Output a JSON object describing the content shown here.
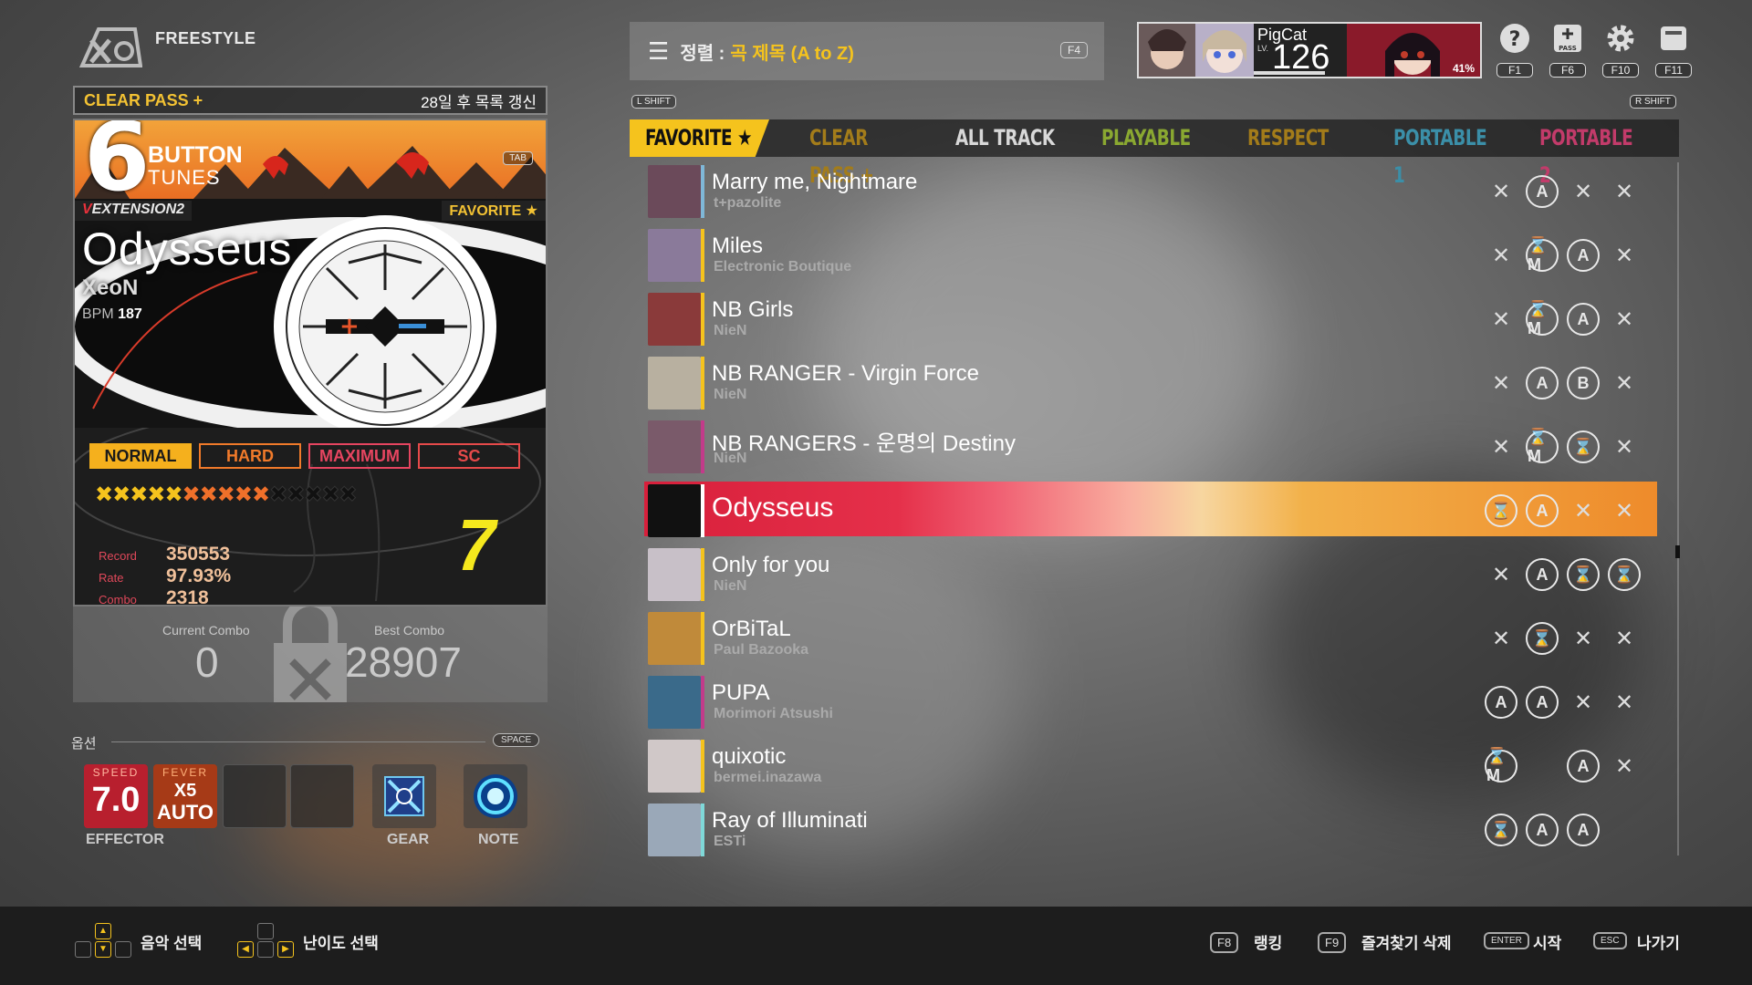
{
  "app": {
    "mode": "FREESTYLE"
  },
  "left": {
    "clear_pass": "CLEAR PASS +",
    "refresh_notice": "28일 후 목록 갱신",
    "button_count": "6",
    "button_label": "BUTTON",
    "tunes_label": "TUNES",
    "tab_key": "TAB",
    "pack_v": "V",
    "pack_rest": "EXTENSION2",
    "favorite_tag": "FAVORITE ★",
    "song_title": "Odysseus",
    "artist": "XeoN",
    "bpm_label": "BPM",
    "bpm_value": "187",
    "difficulties": [
      "NORMAL",
      "HARD",
      "MAXIMUM",
      "SC"
    ],
    "selected_difficulty": "NORMAL",
    "level_stars": {
      "yellow": 5,
      "orange": 5,
      "empty": 5
    },
    "record_label": "Record",
    "record_value": "350553",
    "rate_label": "Rate",
    "rate_value": "97.93%",
    "combo_label": "Combo",
    "combo_value": "2318",
    "grade": "7"
  },
  "combo_panel": {
    "current_label": "Current Combo",
    "current_value": "0",
    "best_label": "Best Combo",
    "best_value": "28907"
  },
  "options": {
    "label": "옵션",
    "space_key": "SPACE",
    "speed_title": "SPEED",
    "speed_value": "7.0",
    "fever_title": "FEVER",
    "fever_multiplier": "X5",
    "fever_mode": "AUTO",
    "effector_label": "EFFECTOR",
    "gear_label": "GEAR",
    "note_label": "NOTE"
  },
  "sort": {
    "label": "정렬 :",
    "value": "곡 제목 (A to Z)",
    "key": "F4"
  },
  "profile": {
    "name": "PigCat",
    "lv_label": "LV.",
    "level": "126",
    "progress_percent": "41%"
  },
  "system_buttons": [
    {
      "icon": "help-icon",
      "key": "F1"
    },
    {
      "icon": "pass-icon",
      "key": "F6",
      "icon_text": "PASS"
    },
    {
      "icon": "gear-icon",
      "key": "F10"
    },
    {
      "icon": "card-icon",
      "key": "F11"
    }
  ],
  "shift_keys": {
    "left": "L SHIFT",
    "right": "R SHIFT"
  },
  "tabs": [
    {
      "label": "FAVORITE ★",
      "color": "#111111",
      "active": true
    },
    {
      "label": "CLEAR PASS +",
      "color": "#a37c1a"
    },
    {
      "label": "ALL TRACK",
      "color": "#d8d8d8"
    },
    {
      "label": "PLAYABLE",
      "color": "#8aa831"
    },
    {
      "label": "RESPECT",
      "color": "#a37c1a"
    },
    {
      "label": "PORTABLE 1",
      "color": "#3b8fa8"
    },
    {
      "label": "PORTABLE 2",
      "color": "#c23b6a"
    }
  ],
  "songs": [
    {
      "title": "Marry me, Nightmare",
      "artist": "t+pazolite",
      "bar": "#7fb8d8",
      "thumb": "#6b4a5a",
      "marks": [
        "x",
        "A",
        "x",
        "x"
      ]
    },
    {
      "title": "Miles",
      "artist": "Electronic Boutique",
      "bar": "#f5c31d",
      "thumb": "#8a7a9a",
      "marks": [
        "x",
        "⌛M",
        "A",
        "x"
      ]
    },
    {
      "title": "NB Girls",
      "artist": "NieN",
      "bar": "#f5c31d",
      "thumb": "#8a3a3a",
      "marks": [
        "x",
        "⌛M",
        "A",
        "x"
      ]
    },
    {
      "title": "NB RANGER - Virgin Force",
      "artist": "NieN",
      "bar": "#f5c31d",
      "thumb": "#b8b0a0",
      "marks": [
        "x",
        "A",
        "B",
        "x"
      ]
    },
    {
      "title": "NB RANGERS - 운명의 Destiny",
      "artist": "NieN",
      "bar": "#c23b8a",
      "thumb": "#7a5a6a",
      "marks": [
        "x",
        "⌛M",
        "⌛",
        "x"
      ]
    },
    {
      "title": "Odysseus",
      "artist": "",
      "bar": "#ffffff",
      "thumb": "#111111",
      "marks": [
        "⌛",
        "A",
        "x",
        "x"
      ],
      "selected": true
    },
    {
      "title": "Only for you",
      "artist": "NieN",
      "bar": "#f5c31d",
      "thumb": "#c8c0c8",
      "marks": [
        "x",
        "A",
        "⌛",
        "⌛"
      ]
    },
    {
      "title": "OrBiTaL",
      "artist": "Paul Bazooka",
      "bar": "#f5c31d",
      "thumb": "#c08a3a",
      "marks": [
        "x",
        "⌛",
        "x",
        "x"
      ]
    },
    {
      "title": "PUPA",
      "artist": "Morimori Atsushi",
      "bar": "#c23b8a",
      "thumb": "#3a6a8a",
      "marks": [
        "A",
        "A",
        "x",
        "x"
      ]
    },
    {
      "title": "quixotic",
      "artist": "bermei.inazawa",
      "bar": "#f5c31d",
      "thumb": "#d0c8c8",
      "marks": [
        "⌛M",
        "",
        "A",
        "x"
      ]
    },
    {
      "title": "Ray of Illuminati",
      "artist": "ESTi",
      "bar": "#7fd8d8",
      "thumb": "#9aa8b8",
      "marks": [
        "⌛",
        "A",
        "A",
        ""
      ]
    }
  ],
  "bottom": {
    "music_select": "음악 선택",
    "difficulty_select": "난이도 선택",
    "f8_key": "F8",
    "ranking": "랭킹",
    "f9_key": "F9",
    "remove_favorite": "즐겨찾기 삭제",
    "enter_key": "ENTER",
    "start": "시작",
    "esc_key": "ESC",
    "exit": "나가기"
  }
}
